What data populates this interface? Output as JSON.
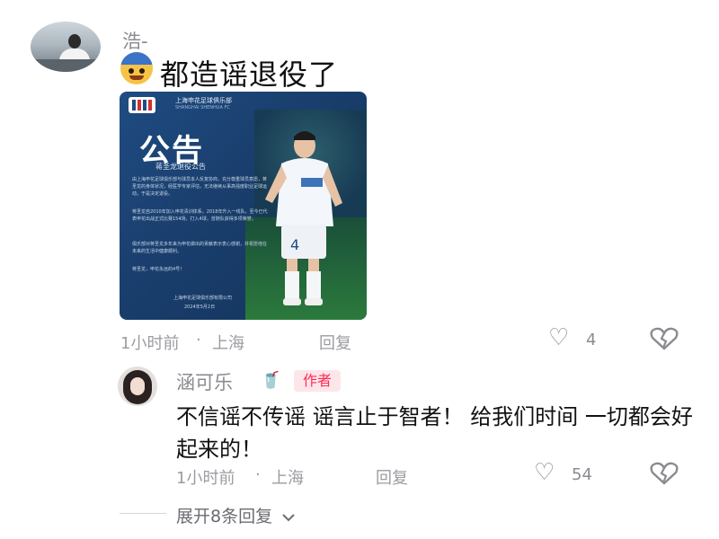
{
  "comment1": {
    "author": "浩-",
    "text": "都造谣退役了",
    "time": "1小时前",
    "location": "上海",
    "reply_label": "回复",
    "like_count": "4",
    "poster": {
      "club_name": "上海申花足球俱乐部",
      "club_name_en": "SHANGHAI SHENHUA FC",
      "title": "公告",
      "subtitle": "蒋圣龙退役公告",
      "paragraphs": [
        "由上海申花足球俱乐部与球员本人反复协商，充分尊重球员意愿，蒋圣龙的身体状况，经医学专家评估，无法继续从事高强度职业足球运动，于是决定退役。",
        "蒋圣龙自2010年加入申花青训体系，2018年升入一线队，至今已代表申花出战正式比赛154场，打入4球，曾随队获得多项荣誉。",
        "俱乐部对蒋圣龙多年来为申花做出的贡献表示衷心感谢，并祝愿他在未来的生活中健康顺利。",
        "蒋圣龙，申花永远的4号！"
      ],
      "footer_org": "上海申花足球俱乐部有限公司",
      "footer_date": "2024年5月2日"
    }
  },
  "comment2": {
    "author": "涵可乐",
    "author_badge": "作者",
    "text": "不信谣不传谣 谣言止于智者！ 给我们时间 一切都会好起来的！",
    "time": "1小时前",
    "location": "上海",
    "reply_label": "回复",
    "like_count": "54"
  },
  "separator": "·",
  "expand_replies": "展开8条回复"
}
